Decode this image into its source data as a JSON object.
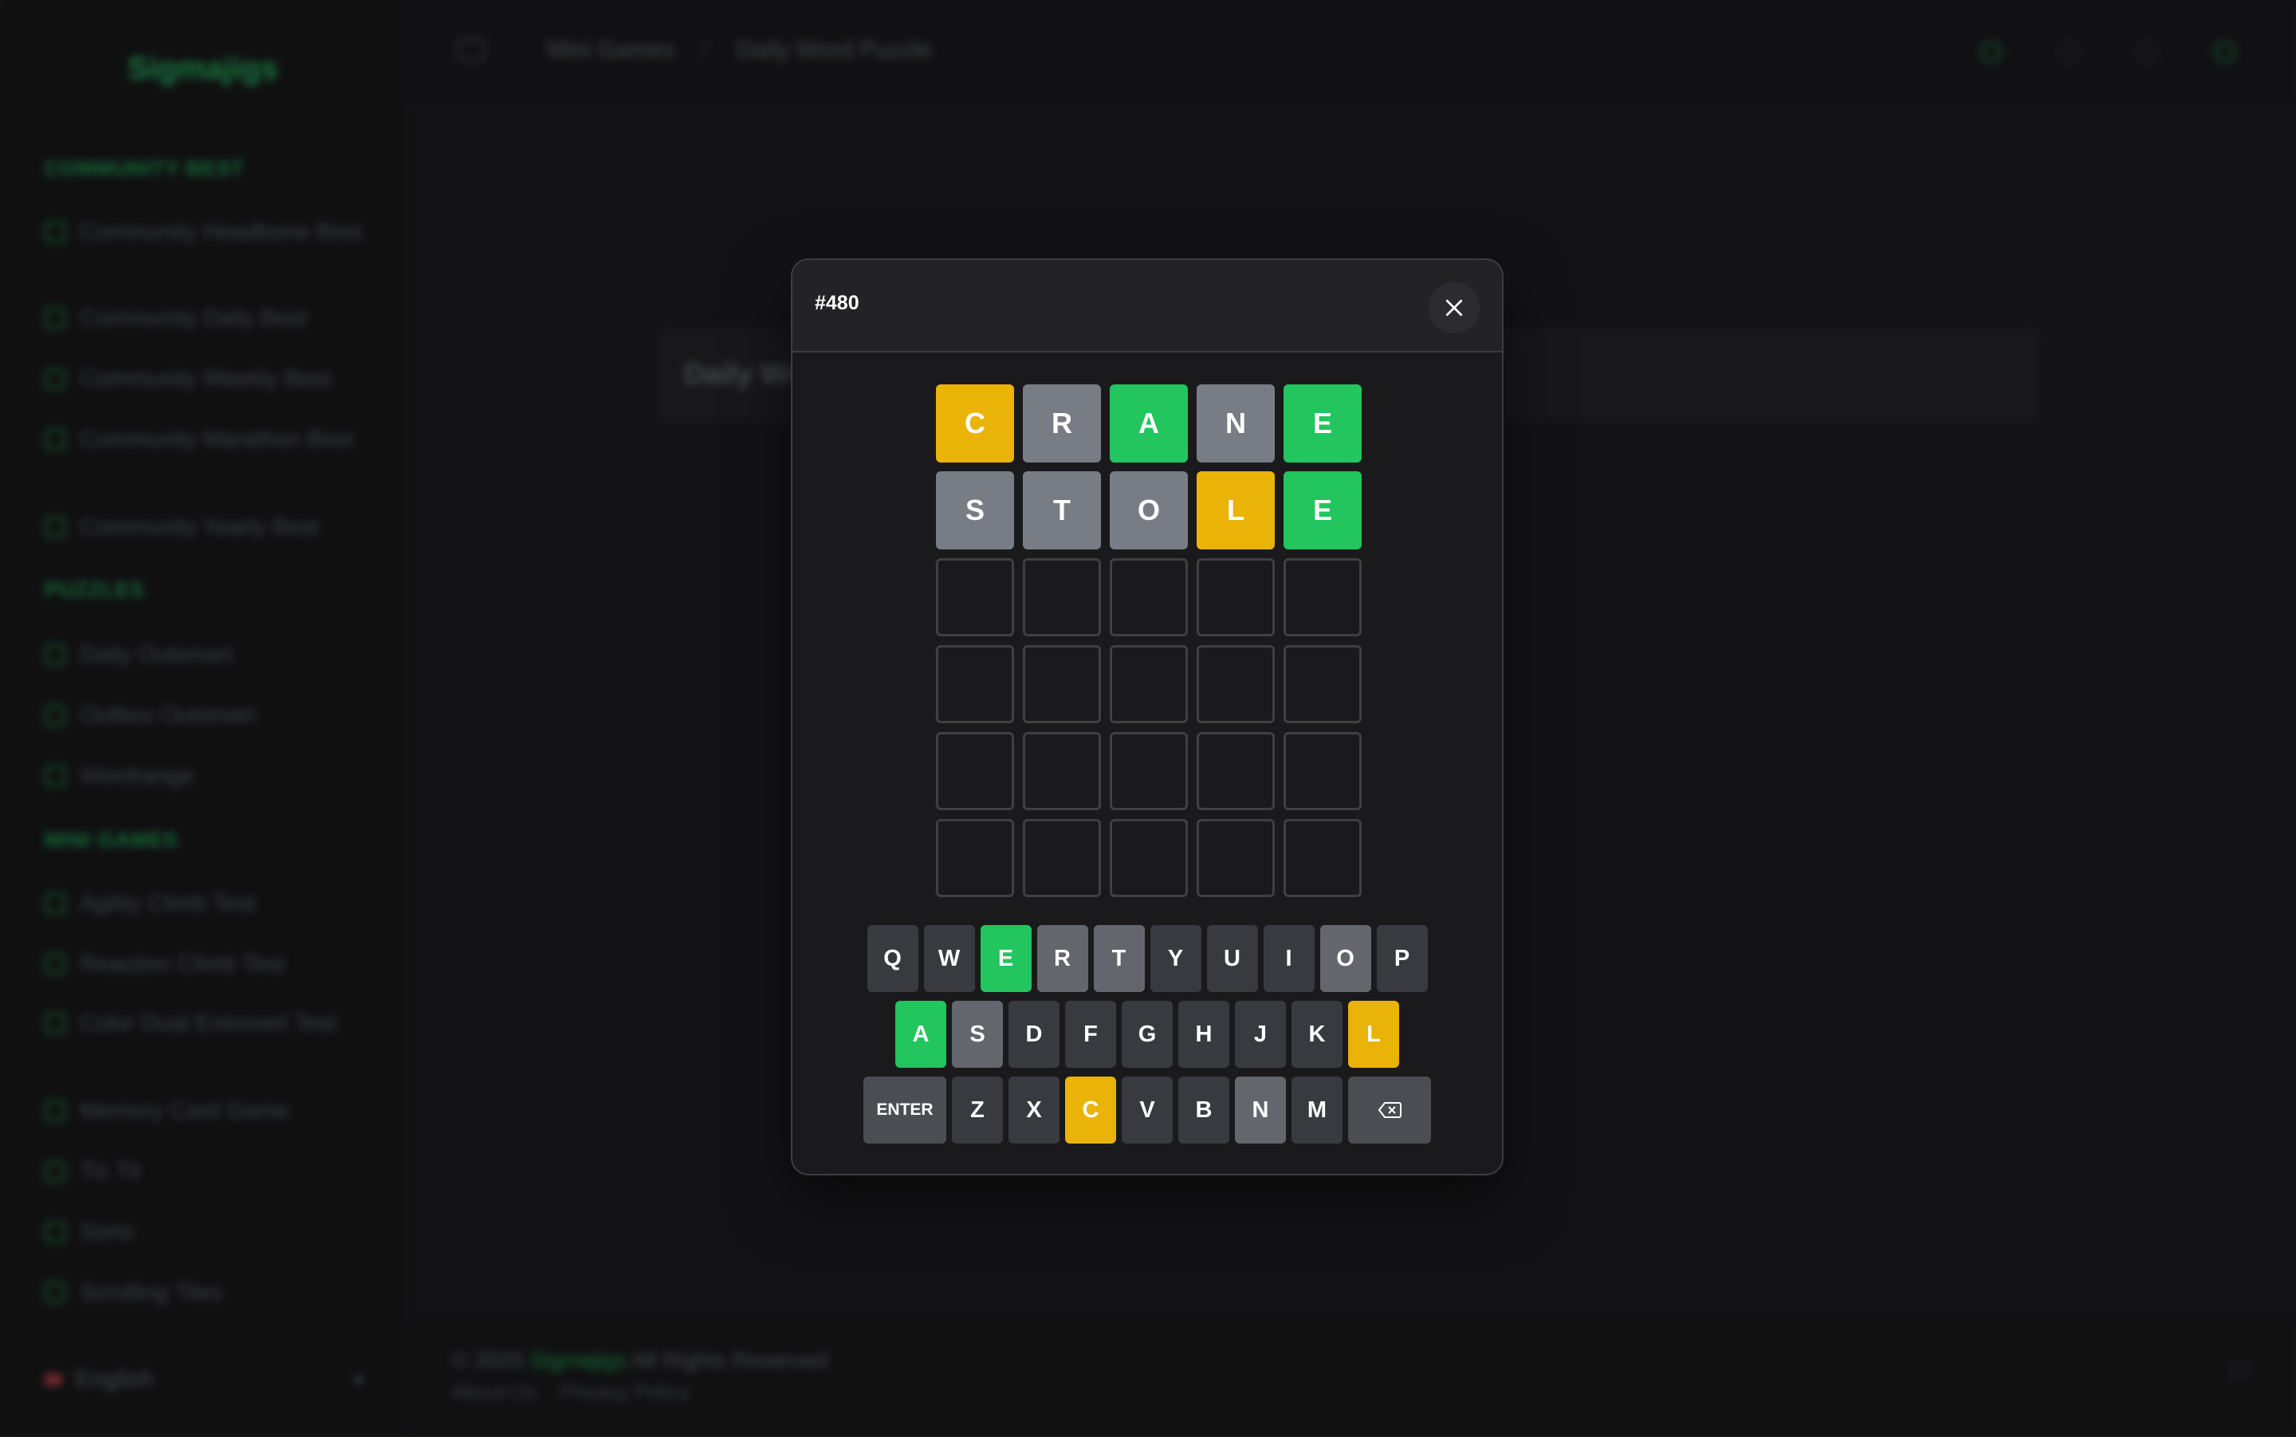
{
  "app": {
    "logo": "Sigmajigs"
  },
  "sidebar": {
    "sections": [
      {
        "title": "COMMUNITY BEST",
        "items": [
          "Community Headbone Best",
          "Community Daily Best",
          "Community Weekly Best",
          "Community Marathon Best",
          "Community Yearly Best"
        ]
      },
      {
        "title": "PUZZLES",
        "items": [
          "Daily Outsmart",
          "Outbox Outsmart",
          "Wordrange"
        ]
      },
      {
        "title": "MINI GAMES",
        "items": [
          "Agility Climb Test",
          "Reaction Climb Test",
          "Color Dual Extrovert Test",
          "Memory Card Game",
          "Tic Tit",
          "Sorts",
          "Scrolling Tiles"
        ]
      }
    ],
    "language": "English"
  },
  "header": {
    "breadcrumb": [
      "Mini Games",
      "Daily Word Puzzle"
    ]
  },
  "main": {
    "card_title": "Daily Wo"
  },
  "footer": {
    "copyright_prefix": "© 2025",
    "brand": "Sigmajigs",
    "copyright_suffix": "All Rights Reserved",
    "links": [
      "About Us",
      "Privacy Policy"
    ]
  },
  "modal": {
    "puzzle_number": "#480",
    "close_icon": "close-icon",
    "board": [
      [
        {
          "l": "C",
          "s": "yellow"
        },
        {
          "l": "R",
          "s": "gray"
        },
        {
          "l": "A",
          "s": "green"
        },
        {
          "l": "N",
          "s": "gray"
        },
        {
          "l": "E",
          "s": "green"
        }
      ],
      [
        {
          "l": "S",
          "s": "gray"
        },
        {
          "l": "T",
          "s": "gray"
        },
        {
          "l": "O",
          "s": "gray"
        },
        {
          "l": "L",
          "s": "yellow"
        },
        {
          "l": "E",
          "s": "green"
        }
      ],
      [
        {
          "l": "",
          "s": "empty"
        },
        {
          "l": "",
          "s": "empty"
        },
        {
          "l": "",
          "s": "empty"
        },
        {
          "l": "",
          "s": "empty"
        },
        {
          "l": "",
          "s": "empty"
        }
      ],
      [
        {
          "l": "",
          "s": "empty"
        },
        {
          "l": "",
          "s": "empty"
        },
        {
          "l": "",
          "s": "empty"
        },
        {
          "l": "",
          "s": "empty"
        },
        {
          "l": "",
          "s": "empty"
        }
      ],
      [
        {
          "l": "",
          "s": "empty"
        },
        {
          "l": "",
          "s": "empty"
        },
        {
          "l": "",
          "s": "empty"
        },
        {
          "l": "",
          "s": "empty"
        },
        {
          "l": "",
          "s": "empty"
        }
      ],
      [
        {
          "l": "",
          "s": "empty"
        },
        {
          "l": "",
          "s": "empty"
        },
        {
          "l": "",
          "s": "empty"
        },
        {
          "l": "",
          "s": "empty"
        },
        {
          "l": "",
          "s": "empty"
        }
      ]
    ],
    "keyboard": [
      [
        {
          "k": "Q",
          "s": "absent"
        },
        {
          "k": "W",
          "s": "absent"
        },
        {
          "k": "E",
          "s": "green"
        },
        {
          "k": "R",
          "s": "used"
        },
        {
          "k": "T",
          "s": "used"
        },
        {
          "k": "Y",
          "s": "absent"
        },
        {
          "k": "U",
          "s": "absent"
        },
        {
          "k": "I",
          "s": "absent"
        },
        {
          "k": "O",
          "s": "used"
        },
        {
          "k": "P",
          "s": "absent"
        }
      ],
      [
        {
          "k": "A",
          "s": "green"
        },
        {
          "k": "S",
          "s": "used"
        },
        {
          "k": "D",
          "s": "absent"
        },
        {
          "k": "F",
          "s": "absent"
        },
        {
          "k": "G",
          "s": "absent"
        },
        {
          "k": "H",
          "s": "absent"
        },
        {
          "k": "J",
          "s": "absent"
        },
        {
          "k": "K",
          "s": "absent"
        },
        {
          "k": "L",
          "s": "yellow"
        }
      ],
      [
        {
          "k": "ENTER",
          "s": "wide"
        },
        {
          "k": "Z",
          "s": "absent"
        },
        {
          "k": "X",
          "s": "absent"
        },
        {
          "k": "C",
          "s": "yellow"
        },
        {
          "k": "V",
          "s": "absent"
        },
        {
          "k": "B",
          "s": "absent"
        },
        {
          "k": "N",
          "s": "used"
        },
        {
          "k": "M",
          "s": "absent"
        },
        {
          "k": "",
          "s": "backspace",
          "icon": "backspace-icon"
        }
      ]
    ]
  },
  "colors": {
    "correct": "#22c55e",
    "present": "#eab308",
    "absent": "#787c84",
    "background": "#19191b"
  }
}
